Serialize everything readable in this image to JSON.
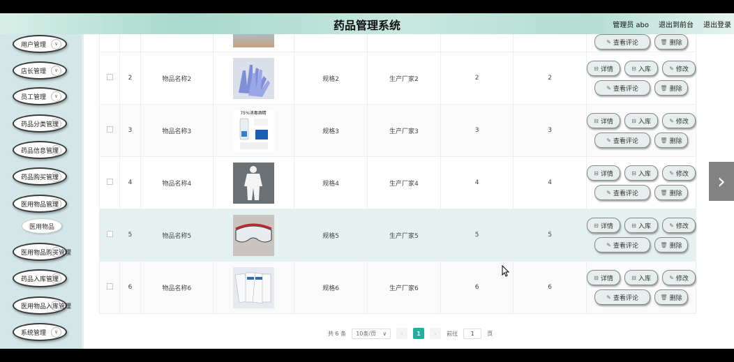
{
  "header": {
    "title": "药品管理系统",
    "admin_label": "管理员 abo",
    "front_label": "退出到前台",
    "logout_label": "退出登录"
  },
  "sidebar": {
    "items": [
      {
        "label": "用户管理",
        "chevron": "chevron-down-icon"
      },
      {
        "label": "店长管理",
        "chevron": "chevron-down-icon"
      },
      {
        "label": "员工管理",
        "chevron": "chevron-down-icon"
      },
      {
        "label": "药品分类管理",
        "chevron": "chevron-down-icon"
      },
      {
        "label": "药品信息管理",
        "chevron": "chevron-down-icon"
      },
      {
        "label": "药品购买管理",
        "chevron": "chevron-down-icon"
      },
      {
        "label": "医用物品管理",
        "chevron": "chevron-down-icon"
      },
      {
        "label": "医用物品购买管理",
        "chevron": "chevron-down-icon"
      },
      {
        "label": "药品入库管理",
        "chevron": "chevron-down-icon"
      },
      {
        "label": "医用物品入库管理",
        "chevron": "chevron-down-icon"
      },
      {
        "label": "系统管理",
        "chevron": "chevron-down-icon"
      }
    ],
    "sub_item": "医用物品"
  },
  "buttons": {
    "detail": "详情",
    "stock_in": "入库",
    "edit": "修改",
    "review": "查看评论",
    "delete": "删除"
  },
  "table": {
    "rows": [
      {
        "index": "2",
        "name": "物品名称2",
        "spec": "规格2",
        "maker": "生产厂家2",
        "col6": "2",
        "col7": "2",
        "image": "gloves"
      },
      {
        "index": "3",
        "name": "物品名称3",
        "spec": "规格3",
        "maker": "生产厂家3",
        "col6": "3",
        "col7": "3",
        "image": "alcohol",
        "image_text": "75%消毒酒精"
      },
      {
        "index": "4",
        "name": "物品名称4",
        "spec": "规格4",
        "maker": "生产厂家4",
        "col6": "4",
        "col7": "4",
        "image": "protective-suit"
      },
      {
        "index": "5",
        "name": "物品名称5",
        "spec": "规格5",
        "maker": "生产厂家5",
        "col6": "5",
        "col7": "5",
        "image": "goggles"
      },
      {
        "index": "6",
        "name": "物品名称6",
        "spec": "规格6",
        "maker": "生产厂家6",
        "col6": "6",
        "col7": "6",
        "image": "swab-packs"
      }
    ]
  },
  "pager": {
    "total": "共 6 条",
    "page_size": "10条/页",
    "current": "1",
    "goto_label": "前往",
    "goto_value": "1",
    "page_suffix": "页"
  },
  "colors": {
    "accent": "#1fb19e",
    "sidebar_bg": "#d3e7e8",
    "row_hover": "#e5f0f0"
  }
}
